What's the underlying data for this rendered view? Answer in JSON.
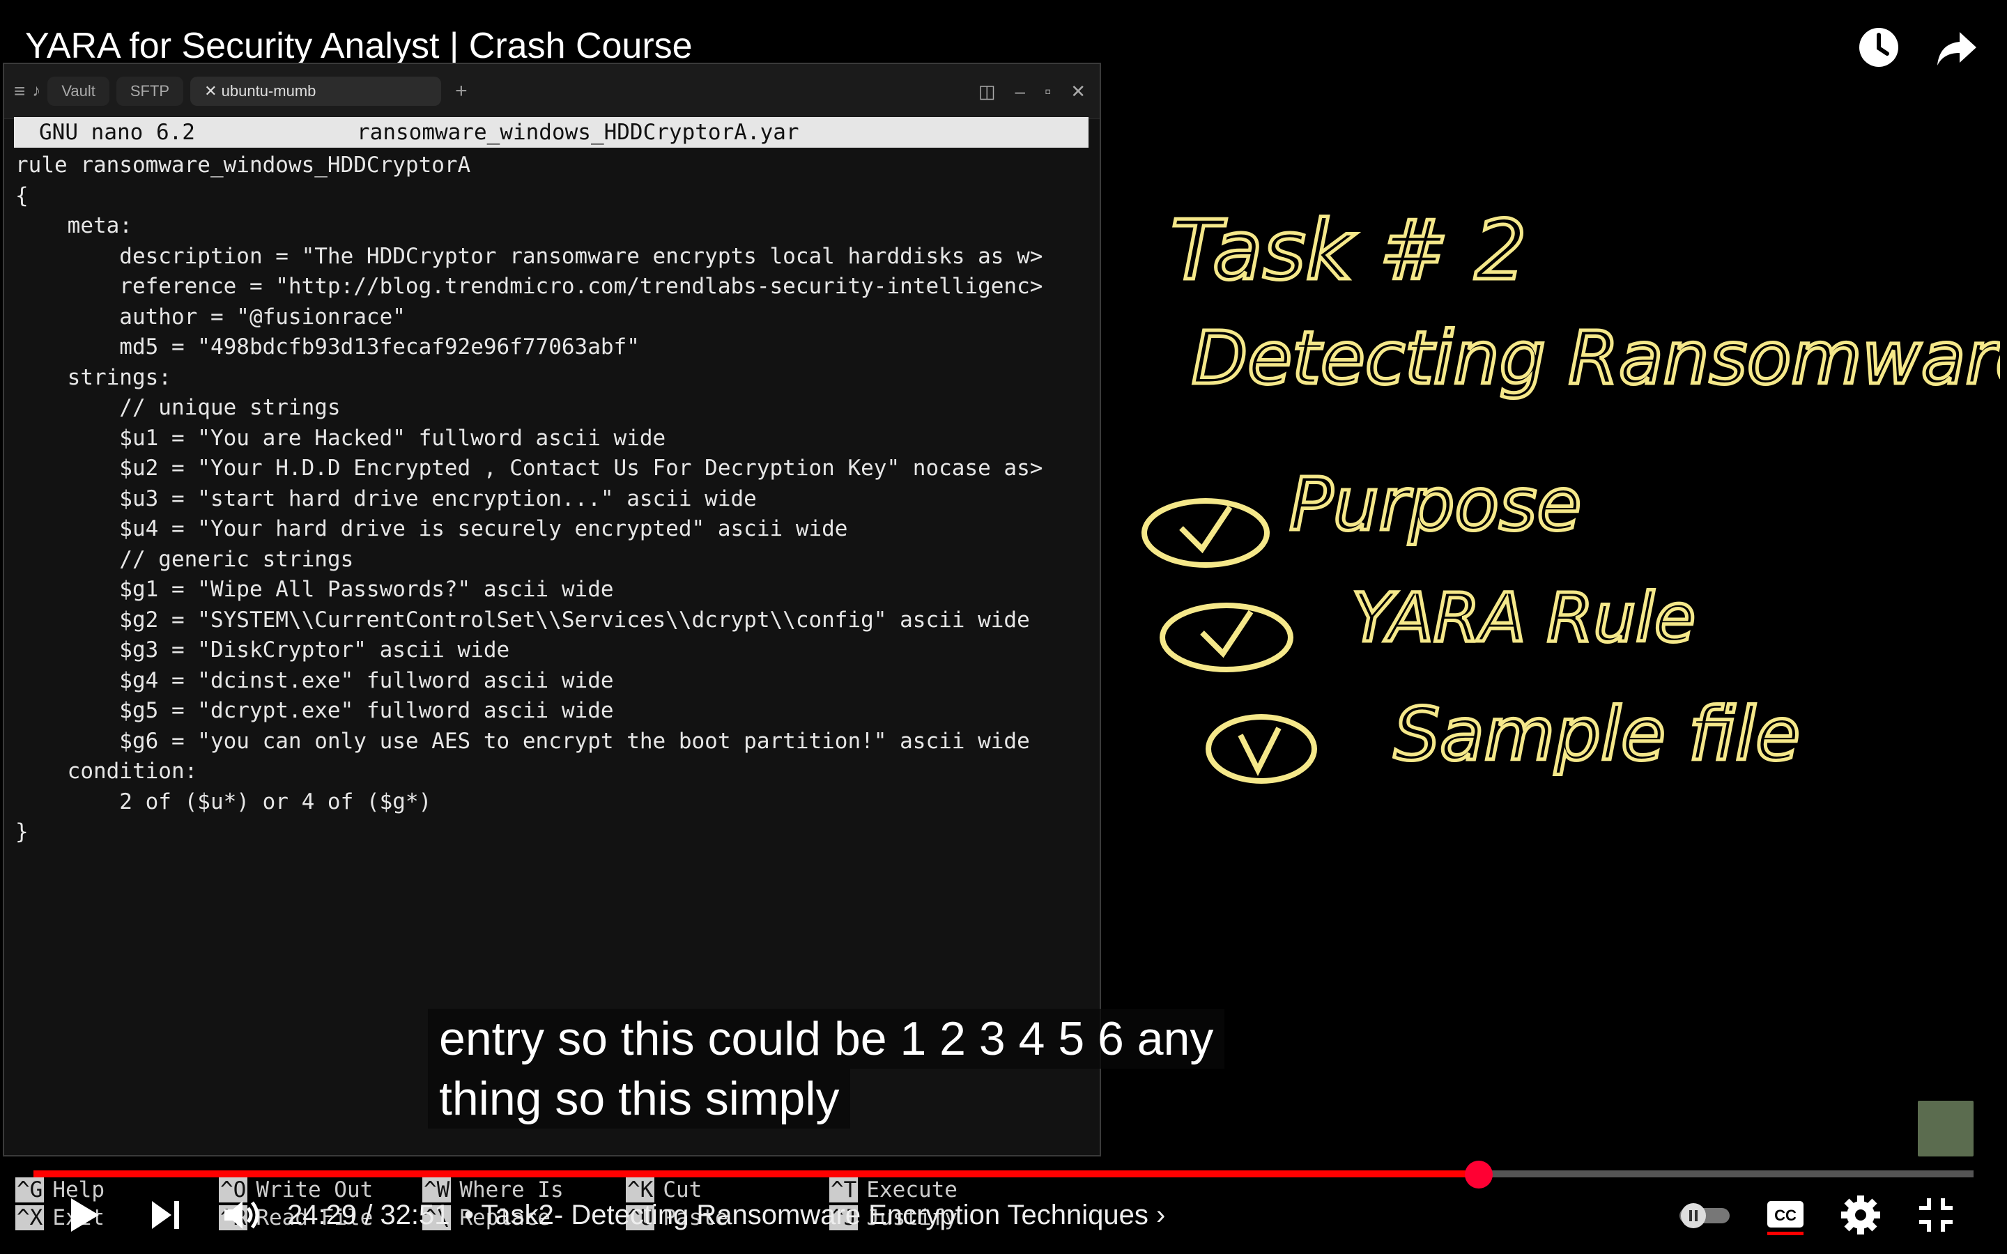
{
  "video": {
    "title": "YARA for Security Analyst | Crash Course"
  },
  "terminal": {
    "tabs": [
      "Vault",
      "SFTP",
      "ubuntu-mumb"
    ],
    "nano_version": "GNU nano 6.2",
    "file_name": "ransomware_windows_HDDCryptorA.yar",
    "lines": [
      "rule ransomware_windows_HDDCryptorA",
      "{",
      "    meta:",
      "        description = \"The HDDCryptor ransomware encrypts local harddisks as w>",
      "        reference = \"http://blog.trendmicro.com/trendlabs-security-intelligenc>",
      "        author = \"@fusionrace\"",
      "        md5 = \"498bdcfb93d13fecaf92e96f77063abf\"",
      "    strings:",
      "        // unique strings",
      "        $u1 = \"You are Hacked\" fullword ascii wide",
      "        $u2 = \"Your H.D.D Encrypted , Contact Us For Decryption Key\" nocase as>",
      "        $u3 = \"start hard drive encryption...\" ascii wide",
      "        $u4 = \"Your hard drive is securely encrypted\" ascii wide",
      "        // generic strings",
      "        $g1 = \"Wipe All Passwords?\" ascii wide",
      "        $g2 = \"SYSTEM\\\\CurrentControlSet\\\\Services\\\\dcrypt\\\\config\" ascii wide",
      "        $g3 = \"DiskCryptor\" ascii wide",
      "        $g4 = \"dcinst.exe\" fullword ascii wide",
      "        $g5 = \"dcrypt.exe\" fullword ascii wide",
      "        $g6 = \"you can only use AES to encrypt the boot partition!\" ascii wide",
      "    condition:",
      "        2 of ($u*) or 4 of ($g*)",
      "}"
    ],
    "shortcuts": [
      {
        "key": "^G",
        "label": "Help"
      },
      {
        "key": "^O",
        "label": "Write Out"
      },
      {
        "key": "^W",
        "label": "Where Is"
      },
      {
        "key": "^K",
        "label": "Cut"
      },
      {
        "key": "^T",
        "label": "Execute"
      },
      {
        "key": "^X",
        "label": "Exit"
      },
      {
        "key": "^R",
        "label": "Read File"
      },
      {
        "key": "^\\",
        "label": "Replace"
      },
      {
        "key": "^U",
        "label": "Paste"
      },
      {
        "key": "^J",
        "label": "Justify"
      }
    ]
  },
  "whiteboard": {
    "heading_1": "Task # 2",
    "heading_2": "Detecting Ransomware",
    "checklist": [
      "Purpose",
      "YARA Rule",
      "Sample file"
    ]
  },
  "caption": {
    "line1": "entry so this could be 1 2 3 4 5 6 any",
    "line2": "thing so this simply"
  },
  "player": {
    "current_time": "24:29",
    "duration": "32:51",
    "time_text": "24:29 / 32:51",
    "chapter": "• Task2- Detecting Ransomware Encryption Techniques",
    "progress_fraction": 0.745,
    "accent_color": "#ff0033"
  }
}
